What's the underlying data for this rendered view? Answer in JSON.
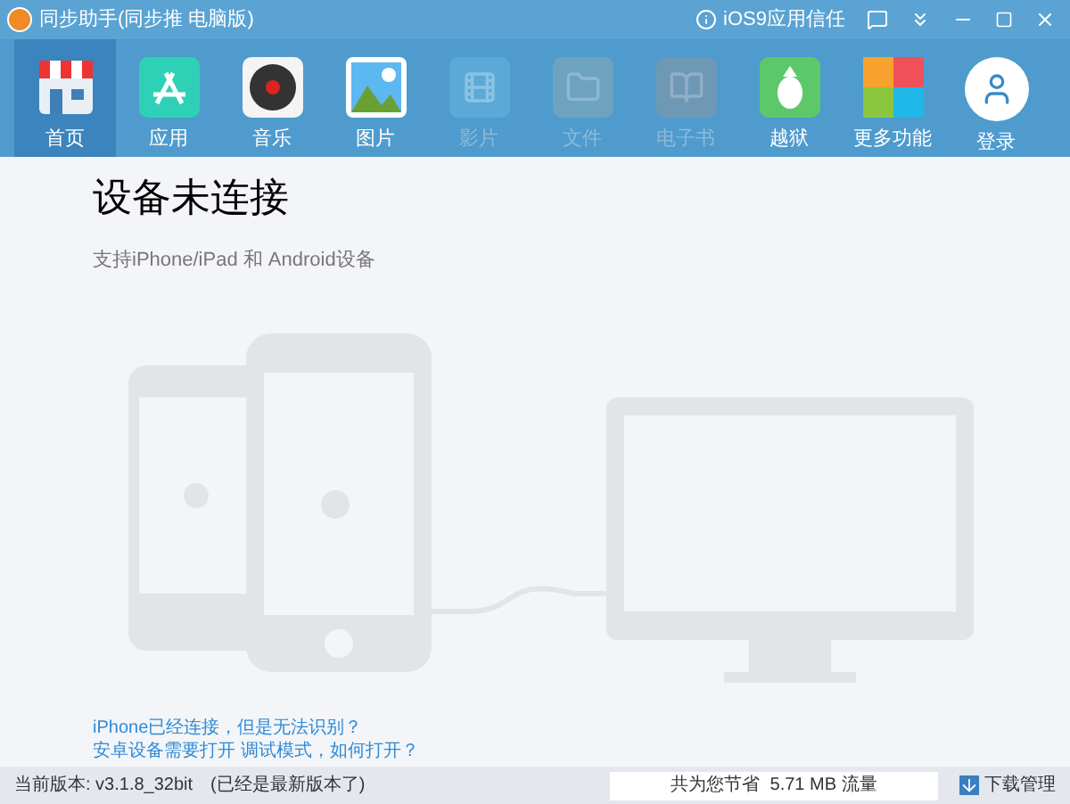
{
  "window": {
    "title": "同步助手(同步推 电脑版)",
    "trust_link": "iOS9应用信任"
  },
  "toolbar": [
    {
      "kind": "home",
      "label": "首页",
      "selected": true,
      "disabled": false
    },
    {
      "kind": "apps",
      "label": "应用",
      "selected": false,
      "disabled": false
    },
    {
      "kind": "music",
      "label": "音乐",
      "selected": false,
      "disabled": false
    },
    {
      "kind": "photos",
      "label": "图片",
      "selected": false,
      "disabled": false
    },
    {
      "kind": "video",
      "label": "影片",
      "selected": false,
      "disabled": true
    },
    {
      "kind": "files",
      "label": "文件",
      "selected": false,
      "disabled": true
    },
    {
      "kind": "books",
      "label": "电子书",
      "selected": false,
      "disabled": true
    },
    {
      "kind": "jailbreak",
      "label": "越狱",
      "selected": false,
      "disabled": false
    },
    {
      "kind": "more",
      "label": "更多功能",
      "selected": false,
      "disabled": false
    },
    {
      "kind": "login",
      "label": "登录",
      "selected": false,
      "disabled": false
    }
  ],
  "main": {
    "title": "设备未连接",
    "subtitle": "支持iPhone/iPad 和 Android设备",
    "links": [
      "iPhone已经连接，但是无法识别？",
      "安卓设备需要打开 调试模式，如何打开？"
    ]
  },
  "status_bar": {
    "version": "当前版本: v3.1.8_32bit",
    "version_note": "(已经是最新版本了)",
    "savings": "共为您节省  5.71 MB 流量",
    "download_manager": "下载管理"
  }
}
